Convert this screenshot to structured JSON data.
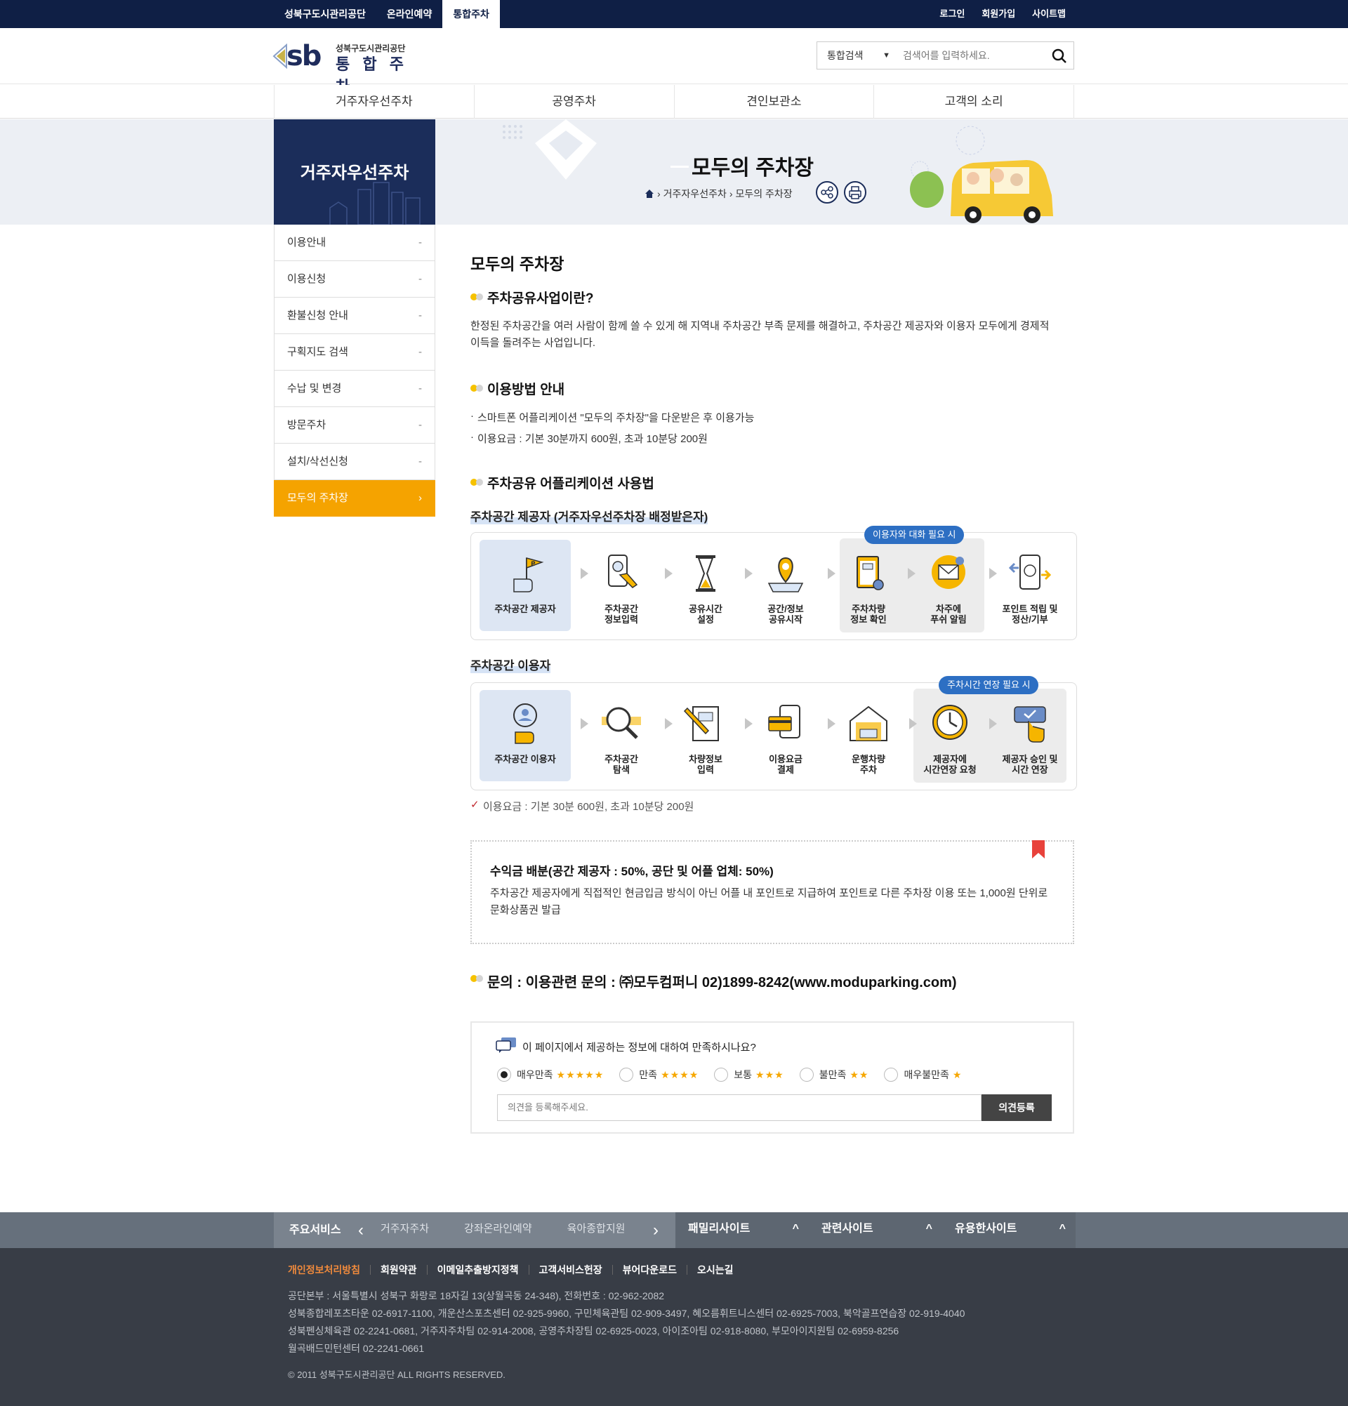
{
  "topbar": {
    "left_links": [
      "성북구도시관리공단",
      "온라인예약",
      "통합주차"
    ],
    "right_links": [
      "로그인",
      "회원가입",
      "사이트맵"
    ]
  },
  "header": {
    "logo_mark": "sb",
    "logo_org": "성북구도시관리공단",
    "logo_name": "통 합 주 차",
    "search_select": "통합검색",
    "search_placeholder": "검색어를 입력하세요."
  },
  "gnb": [
    "거주자우선주차",
    "공영주차",
    "견인보관소",
    "고객의 소리"
  ],
  "sub_visual": {
    "section_title": "거주자우선주차",
    "page_title": "모두의 주차장",
    "breadcrumb": [
      "거주자우선주차",
      "모두의 주차장"
    ]
  },
  "lnb": [
    "이용안내",
    "이용신청",
    "환불신청 안내",
    "구획지도 검색",
    "수납 및 변경",
    "방문주차",
    "설치/삭선신청",
    "모두의 주차장"
  ],
  "content": {
    "title": "모두의 주차장",
    "sec1_title": "주차공유사업이란?",
    "sec1_text": "한정된 주차공간을 여러 사람이 함께 쓸 수 있게 해 지역내 주차공간 부족 문제를 해결하고, 주차공간 제공자와 이용자 모두에게 경제적 이득을 돌려주는 사업입니다.",
    "sec2_title": "이용방법 안내",
    "sec2_items": [
      "스마트폰 어플리케이션 \"모두의 주차장\"을 다운받은 후 이용가능",
      "이용요금 : 기본 30분까지 600원, 초과 10분당 200원"
    ],
    "sec3_title": "주차공유 어플리케이션 사용법",
    "provider_title": "주차공간 제공자 (거주자우선주차장 배정받은자)",
    "provider_tag": "이용자와 대화 필요 시",
    "provider_steps": [
      "주차공간 제공자",
      "주차공간\n정보입력",
      "공유시간\n설정",
      "공간/정보\n공유시작",
      "주차차량\n정보 확인",
      "차주에\n푸쉬 알림",
      "포인트 적립 및\n정산/기부"
    ],
    "user_title": "주차공간 이용자",
    "user_tag": "주차시간 연장 필요 시",
    "user_steps": [
      "주차공간 이용자",
      "주차공간\n탐색",
      "차량정보\n입력",
      "이용요금\n결제",
      "운행차량\n주차",
      "제공자에\n시간연장 요청",
      "제공자 승인 및\n시간 연장"
    ],
    "fee_note": "이용요금 : 기본 30분 600원, 초과 10분당 200원",
    "box_title": "수익금 배분(공간 제공자 : 50%, 공단 및 어플 업체: 50%)",
    "box_text": "주차공간 제공자에게 직접적인 현금입금 방식이 아닌 어플 내 포인트로 지급하여 포인트로 다른 주차장 이용 또는 1,000원 단위로 문화상품권 발급",
    "contact": "문의 : 이용관련 문의 : ㈜모두컴퍼니 02)1899-8242(www.moduparking.com)"
  },
  "survey": {
    "question": "이 페이지에서 제공하는 정보에 대하여 만족하시나요?",
    "options": [
      {
        "label": "매우만족",
        "stars": "★★★★★"
      },
      {
        "label": "만족",
        "stars": "★★★★"
      },
      {
        "label": "보통",
        "stars": "★★★"
      },
      {
        "label": "불만족",
        "stars": "★★"
      },
      {
        "label": "매우불만족",
        "stars": "★"
      }
    ],
    "input_placeholder": "의견을 등록해주세요.",
    "submit": "의견등록"
  },
  "footer": {
    "main_service": "주요서비스",
    "services": [
      "거주자주차",
      "강좌온라인예약",
      "육아종합지원"
    ],
    "family_site": "패밀리사이트",
    "related_site": "관련사이트",
    "useful_site": "유용한사이트",
    "links": [
      "개인정보처리방침",
      "회원약관",
      "이메일추출방지정책",
      "고객서비스헌장",
      "뷰어다운로드",
      "오시는길"
    ],
    "address": [
      "공단본부 : 서울특별시 성북구 화랑로 18자길 13(상월곡동 24-348), 전화번호 : 02-962-2082",
      "성북종합레포츠타운 02-6917-1100, 개운산스포츠센터 02-925-9960, 구민체육관팀 02-909-3497, 혜오름휘트니스센터 02-6925-7003, 북악골프연습장 02-919-4040",
      "성북펜싱체육관 02-2241-0681, 거주자주차팀 02-914-2008, 공영주차장팀 02-6925-0023, 아이조아팀 02-918-8080, 부모아이지원팀 02-6959-8256",
      "월곡배드민턴센터 02-2241-0661"
    ],
    "copyright": "© 2011 성북구도시관리공단 ALL RIGHTS RESERVED."
  },
  "colors": {
    "navy": "#0f1f45",
    "accent": "#f5a300",
    "tag_blue": "#2d6fc3"
  }
}
